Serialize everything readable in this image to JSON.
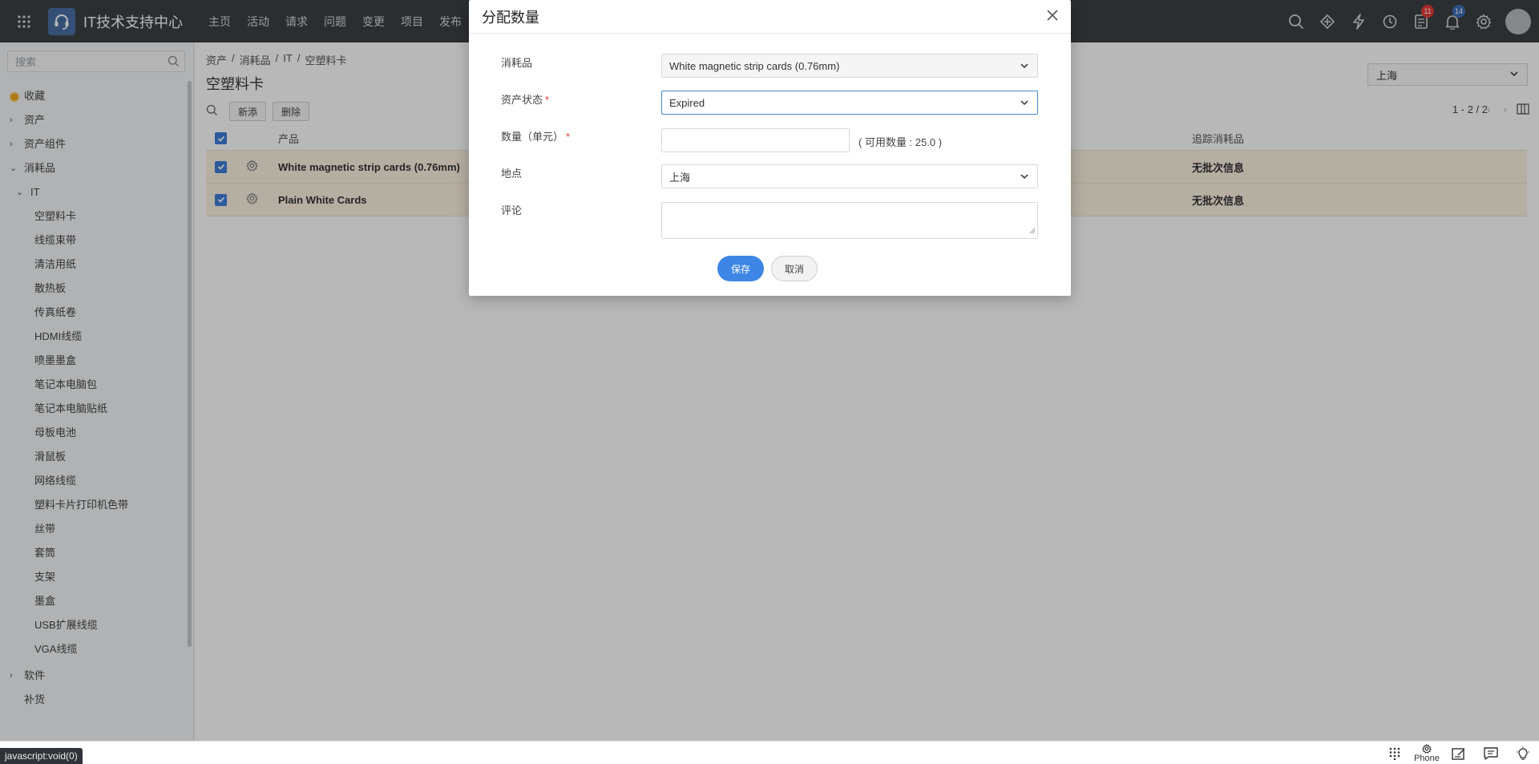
{
  "app": {
    "title": "IT技术支持中心"
  },
  "topnav": [
    "主页",
    "活动",
    "请求",
    "问题",
    "变更",
    "项目",
    "发布"
  ],
  "notifications": {
    "tasks_count": "11",
    "alerts_count": "14"
  },
  "sidebar": {
    "search_placeholder": "搜索",
    "favorites": "收藏",
    "items": [
      {
        "label": "资产",
        "caret": "›"
      },
      {
        "label": "资产组件",
        "caret": "›"
      },
      {
        "label": "消耗品",
        "caret": "⌄"
      },
      {
        "label": "IT",
        "caret": "⌄"
      }
    ],
    "sub_items": [
      "空塑料卡",
      "线缆束带",
      "清洁用纸",
      "散热板",
      "传真纸卷",
      "HDMI线缆",
      "喷墨墨盒",
      "笔记本电脑包",
      "笔记本电脑贴纸",
      "母板电池",
      "滑鼠板",
      "网络线缆",
      "塑料卡片打印机色带",
      "丝带",
      "套筒",
      "支架",
      "墨盒",
      "USB扩展线缆",
      "VGA线缆"
    ],
    "bottom_items": [
      {
        "label": "软件",
        "caret": "›"
      },
      {
        "label": "补货",
        "caret": ""
      }
    ]
  },
  "breadcrumb": [
    "资产",
    "/",
    "消耗品",
    "/",
    "IT",
    "/",
    "空塑料卡"
  ],
  "page": {
    "title": "空塑料卡",
    "new_label": "新添",
    "delete_label": "删除",
    "location": "上海",
    "pagination": "1 - 2 / 2"
  },
  "table": {
    "headers": {
      "product": "产品",
      "track": "追踪消耗品"
    },
    "rows": [
      {
        "product": "White magnetic strip cards (0.76mm)",
        "track": "无批次信息"
      },
      {
        "product": "Plain White Cards",
        "track": "无批次信息"
      }
    ]
  },
  "modal": {
    "title": "分配数量",
    "consumable_label": "消耗品",
    "consumable_value": "White magnetic strip cards (0.76mm)",
    "status_label": "资产状态",
    "status_value": "Expired",
    "quantity_label": "数量（单元）",
    "quantity_value": "",
    "available_text": "( 可用数量 : 25.0 )",
    "location_label": "地点",
    "location_value": "上海",
    "comment_label": "评论",
    "save_label": "保存",
    "cancel_label": "取消"
  },
  "statusbar": {
    "js_tip": "javascript:void(0)",
    "phone_label": "Phone"
  }
}
